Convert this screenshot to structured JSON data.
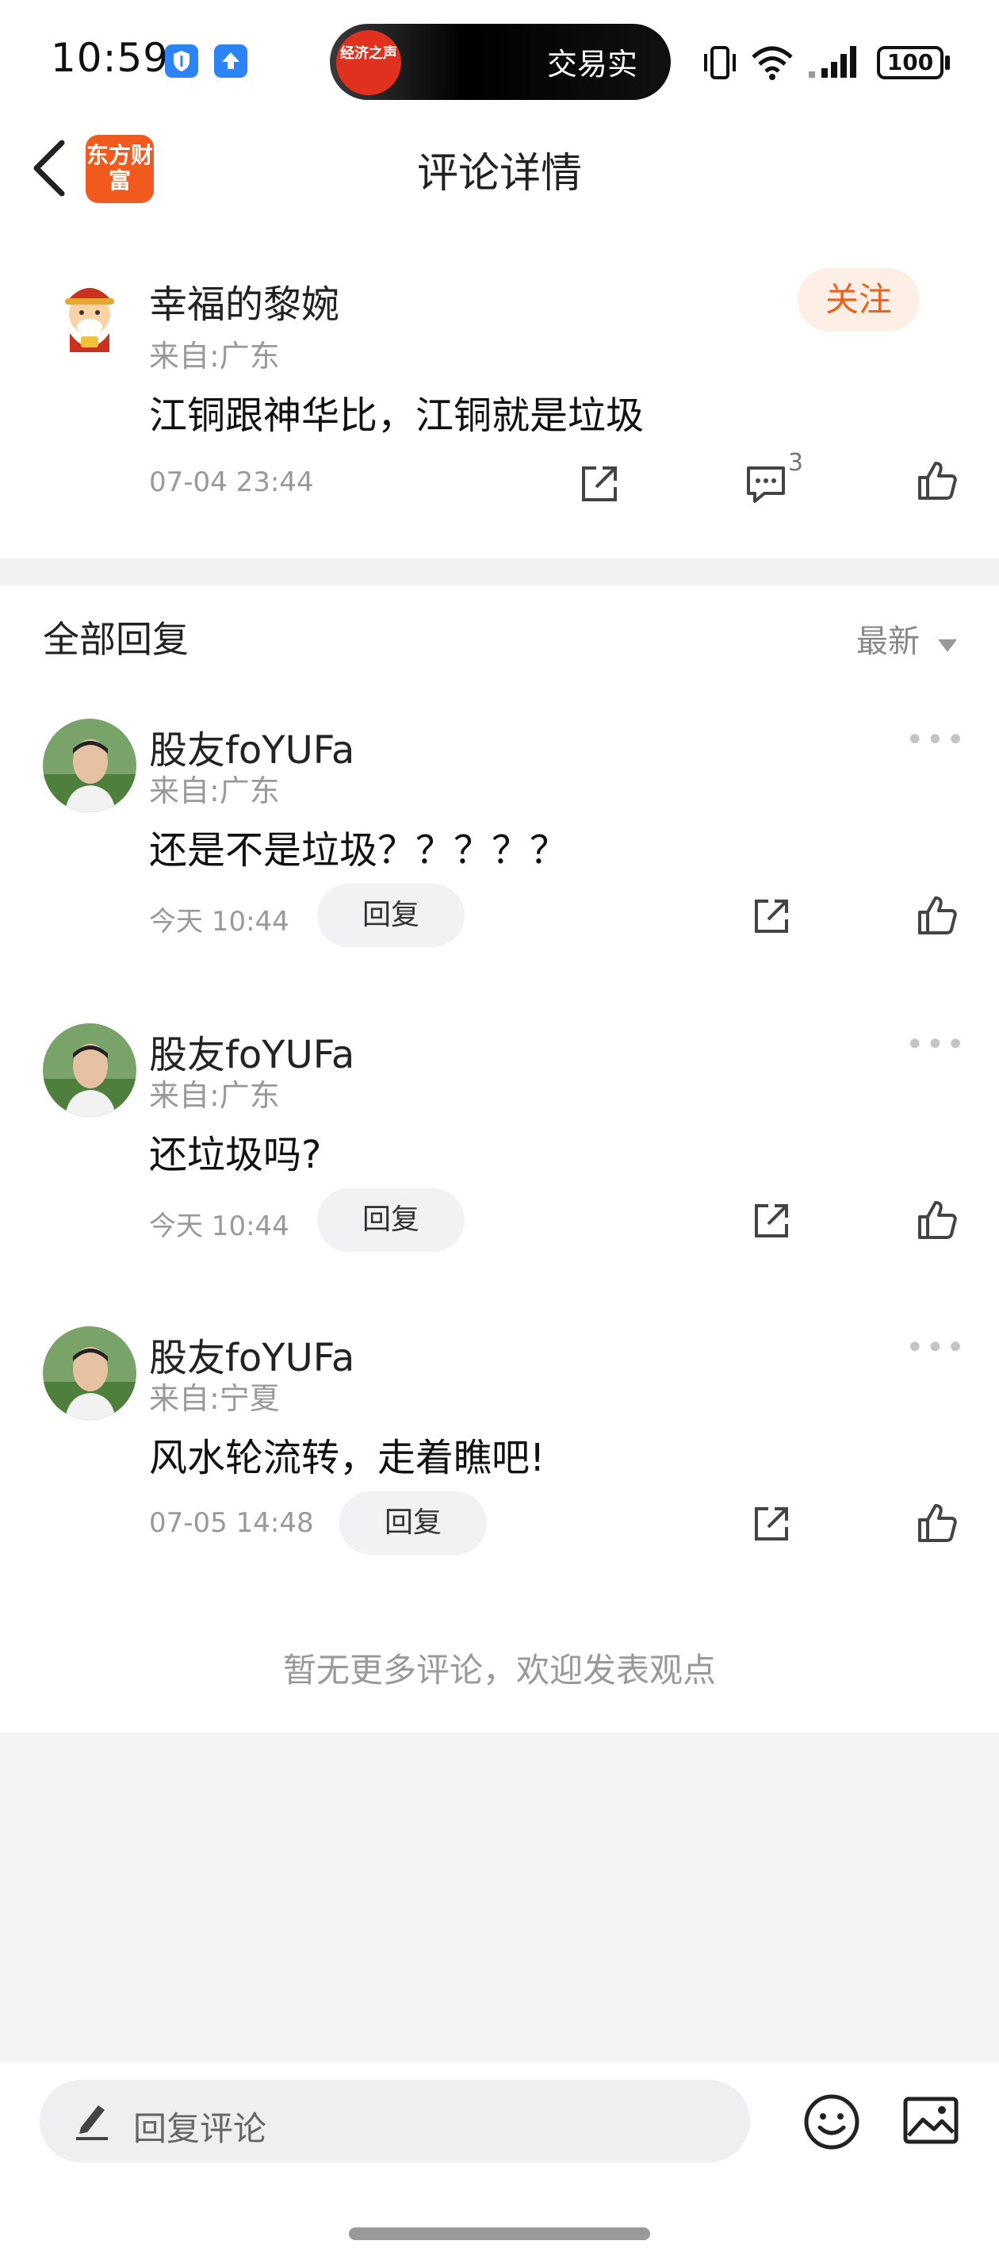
{
  "status_bar": {
    "time": "10:59",
    "island_logo": "经济之声",
    "island_text": "交易实",
    "battery": "100"
  },
  "header": {
    "title": "评论详情",
    "logo_text": "东方财富"
  },
  "main_comment": {
    "user": "幸福的黎婉",
    "origin": "来自:广东",
    "text": "江铜跟神华比，江铜就是垃圾",
    "time": "07-04 23:44",
    "reply_count": "3",
    "follow_label": "关注"
  },
  "replies_section": {
    "title": "全部回复",
    "sort_label": "最新"
  },
  "replies": [
    {
      "user": "股友foYUFa",
      "origin": "来自:广东",
      "text": "还是不是垃圾？？？？？",
      "time": "今天 10:44",
      "reply_label": "回复"
    },
    {
      "user": "股友foYUFa",
      "origin": "来自:广东",
      "text": "还垃圾吗?",
      "time": "今天 10:44",
      "reply_label": "回复"
    },
    {
      "user": "股友foYUFa",
      "origin": "来自:宁夏",
      "text": "风水轮流转，走着瞧吧!",
      "time": "07-05 14:48",
      "reply_label": "回复"
    }
  ],
  "footer_note": "暂无更多评论，欢迎发表观点",
  "bottom_bar": {
    "input_placeholder": "回复评论"
  },
  "icons": [
    "back-icon",
    "share-icon",
    "comment-icon",
    "like-icon",
    "more-icon",
    "sort-arrow-icon",
    "pen-icon",
    "emoji-icon",
    "image-icon"
  ],
  "colors": {
    "accent": "#e7641e",
    "follow_bg": "#fdeee6",
    "muted_text": "#999999"
  }
}
